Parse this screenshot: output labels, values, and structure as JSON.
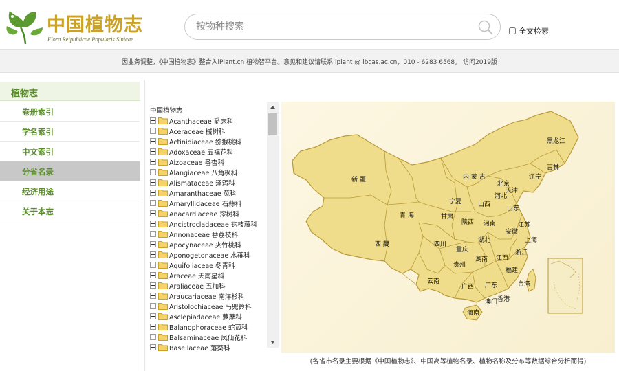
{
  "header": {
    "logo_title": "中国植物志",
    "logo_subtitle": "Flora Reipublicae Popularis Sinicae",
    "search_placeholder": "按物种搜索",
    "fulltext_label": "全文检索"
  },
  "notice": {
    "text": "因业务调整，《中国植物志》整合入iPlant.cn 植物智平台。意见和建议请联系 iplant @ ibcas.ac.cn，010 - 6283 6568。 访问2019版"
  },
  "sidebar": {
    "title": "植物志",
    "items": [
      {
        "label": "卷册索引"
      },
      {
        "label": "学名索引"
      },
      {
        "label": "中文索引"
      },
      {
        "label": "分省名录"
      },
      {
        "label": "经济用途"
      },
      {
        "label": "关于本志"
      }
    ],
    "active_index": 3
  },
  "tree": {
    "root": "中国植物志",
    "families": [
      "Acanthaceae 爵床科",
      "Aceraceae 槭树科",
      "Actinidiaceae 猕猴桃科",
      "Adoxaceae 五福花科",
      "Aizoaceae 番杏科",
      "Alangiaceae 八角枫科",
      "Alismataceae 泽泻科",
      "Amaranthaceae 苋科",
      "Amaryllidaceae 石蒜科",
      "Anacardiaceae 漆树科",
      "Ancistrocladaceae 钩枝藤科",
      "Annonaceae 番荔枝科",
      "Apocynaceae 夹竹桃科",
      "Aponogetonaceae 水蕹科",
      "Aquifoliaceae 冬青科",
      "Araceae 天南星科",
      "Araliaceae 五加科",
      "Araucariaceae 南洋杉科",
      "Aristolochiaceae 马兜铃科",
      "Asclepiadaceae 萝藦科",
      "Balanophoraceae 蛇菰科",
      "Balsaminaceae 凤仙花科",
      "Basellaceae 落葵科"
    ]
  },
  "map": {
    "provinces": [
      "黑龙江",
      "吉林",
      "辽宁",
      "内 蒙 古",
      "新 疆",
      "北京",
      "天津",
      "河北",
      "山西",
      "山东",
      "宁夏",
      "甘肃",
      "青 海",
      "陕西",
      "河南",
      "江苏",
      "上海",
      "安徽",
      "西 藏",
      "四川",
      "湖北",
      "重庆",
      "浙江",
      "贵州",
      "湖南",
      "江西",
      "云南",
      "福建",
      "广西",
      "广东",
      "台湾",
      "香港",
      "澳门",
      "海南"
    ],
    "caption": "(各省市名录主要根据《中国植物志》、中国高等植物名录、植物名称及分布等数据综合分析而得)",
    "colors": {
      "land": "#eedc8a",
      "border": "#b89a3a",
      "background": "#fbf4dc"
    }
  }
}
